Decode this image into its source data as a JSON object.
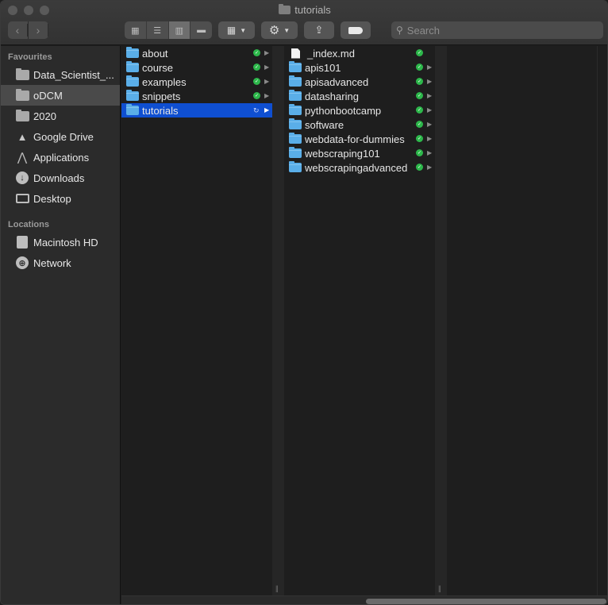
{
  "window": {
    "title": "tutorials"
  },
  "toolbar": {
    "back_icon": "chevron-left",
    "forward_icon": "chevron-right",
    "views": [
      "icon-view",
      "list-view",
      "column-view",
      "gallery-view"
    ],
    "active_view": "column-view",
    "group_icon": "grid",
    "action_icon": "gear",
    "share_icon": "share",
    "tag_icon": "tag",
    "search_placeholder": "Search"
  },
  "sidebar": {
    "favourites_header": "Favourites",
    "favourites": [
      {
        "label": "Data_Scientist_...",
        "icon": "folder"
      },
      {
        "label": "oDCM",
        "icon": "folder",
        "selected": true
      },
      {
        "label": "2020",
        "icon": "folder"
      },
      {
        "label": "Google Drive",
        "icon": "google-drive"
      },
      {
        "label": "Applications",
        "icon": "applications"
      },
      {
        "label": "Downloads",
        "icon": "downloads"
      },
      {
        "label": "Desktop",
        "icon": "desktop"
      }
    ],
    "locations_header": "Locations",
    "locations": [
      {
        "label": "Macintosh HD",
        "icon": "disk"
      },
      {
        "label": "Network",
        "icon": "network"
      }
    ]
  },
  "columns": {
    "col1": [
      {
        "label": "about",
        "type": "folder",
        "status": "synced"
      },
      {
        "label": "course",
        "type": "folder",
        "status": "synced"
      },
      {
        "label": "examples",
        "type": "folder",
        "status": "synced"
      },
      {
        "label": "snippets",
        "type": "folder",
        "status": "synced"
      },
      {
        "label": "tutorials",
        "type": "folder",
        "status": "syncing",
        "selected": true
      }
    ],
    "col2": [
      {
        "label": "_index.md",
        "type": "file",
        "status": "synced"
      },
      {
        "label": "apis101",
        "type": "folder",
        "status": "synced"
      },
      {
        "label": "apisadvanced",
        "type": "folder",
        "status": "synced"
      },
      {
        "label": "datasharing",
        "type": "folder",
        "status": "synced"
      },
      {
        "label": "pythonbootcamp",
        "type": "folder",
        "status": "synced"
      },
      {
        "label": "software",
        "type": "folder",
        "status": "synced"
      },
      {
        "label": "webdata-for-dummies",
        "type": "folder",
        "status": "synced"
      },
      {
        "label": "webscraping101",
        "type": "folder",
        "status": "synced"
      },
      {
        "label": "webscrapingadvanced",
        "type": "folder",
        "status": "synced"
      }
    ]
  },
  "colors": {
    "selection": "#0f4fd1",
    "folder_blue": "#5aaee8",
    "sync_green": "#2db84b"
  }
}
